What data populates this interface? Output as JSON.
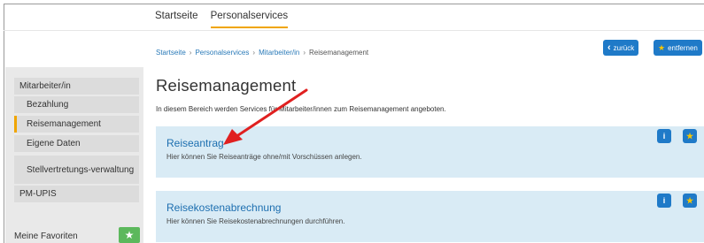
{
  "topnav": {
    "tabs": [
      "Startseite",
      "Personalservices"
    ]
  },
  "breadcrumb": {
    "items": [
      "Startseite",
      "Personalservices",
      "Mitarbeiter/in",
      "Reisemanagement"
    ],
    "sep": "›"
  },
  "buttons": {
    "back": "zurück",
    "back_icon": "‹",
    "remove": "entfernen",
    "star": "★"
  },
  "sidebar": {
    "items": [
      "Mitarbeiter/in",
      "Bezahlung",
      "Reisemanagement",
      "Eigene Daten",
      "Stellvertretungs-verwaltung",
      "PM-UPIS"
    ],
    "bottom_label": "Meine Favoriten",
    "fav_icon": "★"
  },
  "main": {
    "title": "Reisemanagement",
    "intro": "In diesem Bereich werden Services für Mitarbeiter/innen zum Reisemanagement angeboten.",
    "cards": [
      {
        "title": "Reiseantrag",
        "desc": "Hier können Sie Reiseanträge ohne/mit Vorschüssen anlegen."
      },
      {
        "title": "Reisekostenabrechnung",
        "desc": "Hier können Sie Reisekostenabrechnungen durchführen."
      }
    ],
    "info_label": "i"
  },
  "colors": {
    "accent": "#f0a500",
    "primary": "#1f7ac8",
    "card_bg": "#d9ebf5",
    "arrow": "#e02020",
    "fav": "#5cb85c"
  }
}
